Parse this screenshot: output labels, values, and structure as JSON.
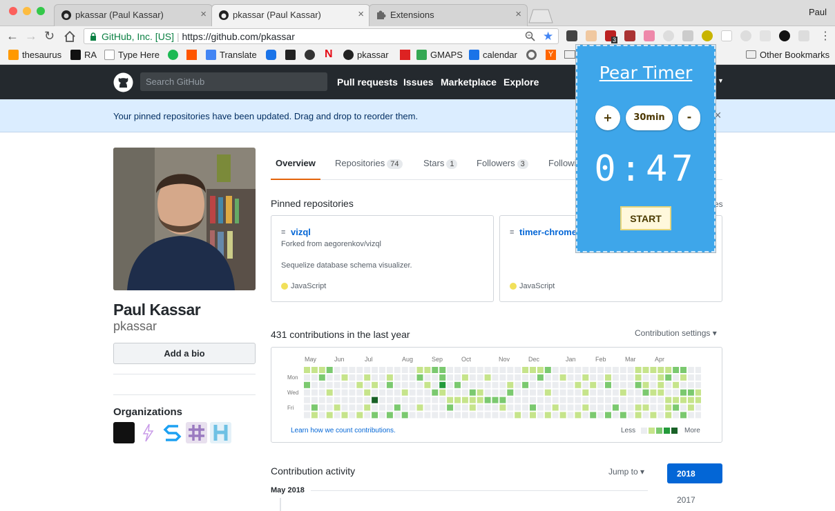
{
  "browser": {
    "tabs": [
      {
        "title": "pkassar (Paul Kassar)",
        "close": "×"
      },
      {
        "title": "pkassar (Paul Kassar)",
        "close": "×"
      },
      {
        "title": "Extensions",
        "close": "×"
      }
    ],
    "profile_name": "Paul",
    "site_identity": "GitHub, Inc. [US]",
    "url": "https://github.com/pkassar",
    "bookmarks": [
      "thesaurus",
      "RA",
      "Type Here",
      "Translate",
      "pkassar",
      "GMAPS",
      "calendar",
      "Y"
    ],
    "other_bookmarks": "Other Bookmarks",
    "extension_badge": "3"
  },
  "github": {
    "search_placeholder": "Search GitHub",
    "nav": [
      "Pull requests",
      "Issues",
      "Marketplace",
      "Explore"
    ],
    "flash": "Your pinned repositories have been updated. Drag and drop to reorder them.",
    "flash_close": "×"
  },
  "profile": {
    "name": "Paul Kassar",
    "login": "pkassar",
    "bio_button": "Add a bio",
    "orgs_title": "Organizations"
  },
  "tabs": [
    {
      "label": "Overview",
      "count": ""
    },
    {
      "label": "Repositories",
      "count": "74"
    },
    {
      "label": "Stars",
      "count": "1"
    },
    {
      "label": "Followers",
      "count": "3"
    },
    {
      "label": "Followi",
      "count": ""
    }
  ],
  "pinned": {
    "title": "Pinned repositories",
    "customize_tail": "es",
    "repos": [
      {
        "name": "vizql",
        "fork": "Forked from aegorenkov/vizql",
        "desc": "Sequelize database schema visualizer.",
        "lang": "JavaScript"
      },
      {
        "name": "timer-chrome",
        "fork": "",
        "desc": "",
        "lang": "JavaScript"
      }
    ]
  },
  "contrib": {
    "title": "431 contributions in the last year",
    "settings": "Contribution settings ▾",
    "months": [
      "May",
      "Jun",
      "Jul",
      "Aug",
      "Sep",
      "Oct",
      "Nov",
      "Dec",
      "Jan",
      "Feb",
      "Mar",
      "Apr"
    ],
    "days": [
      "Mon",
      "Wed",
      "Fri"
    ],
    "learn": "Learn how we count contributions.",
    "less": "Less",
    "more": "More",
    "colors": [
      "#ebedf0",
      "#c6e48b",
      "#7bc96f",
      "#239a3b",
      "#196127"
    ]
  },
  "activity": {
    "title": "Contribution activity",
    "jump": "Jump to ▾",
    "month": "May 2018",
    "years": [
      "2018",
      "2017"
    ]
  },
  "pear_timer": {
    "title": "Pear Timer",
    "plus": "+",
    "duration": "30min",
    "minus": "-",
    "time": "0:47",
    "start": "START"
  }
}
